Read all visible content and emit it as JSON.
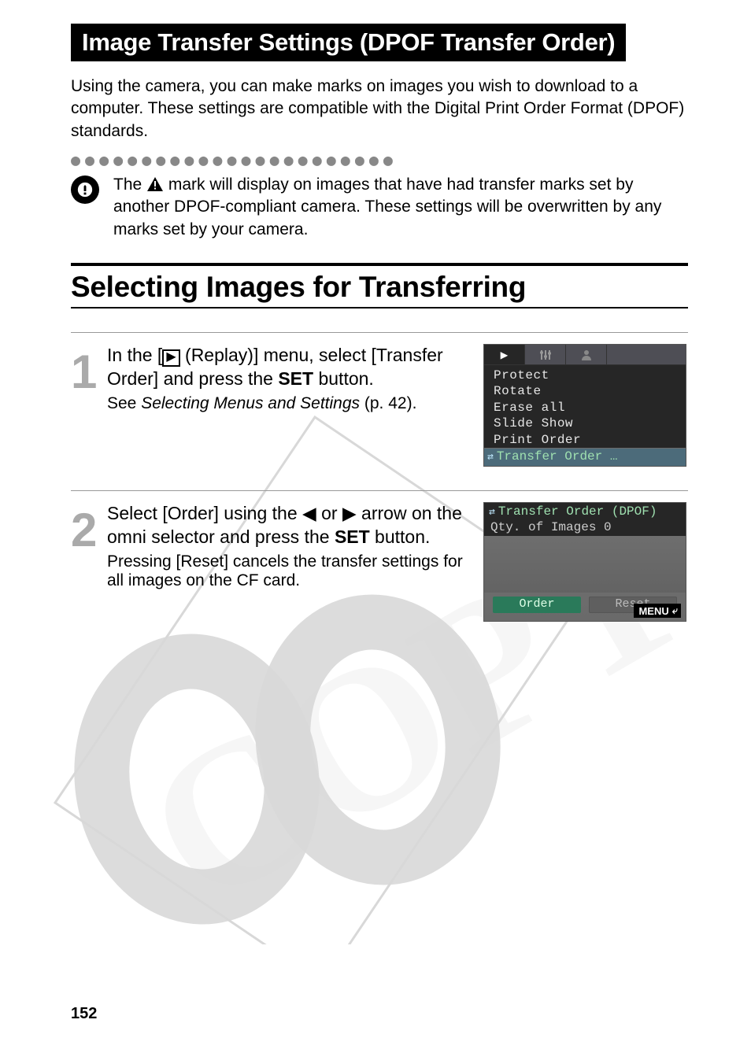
{
  "page": {
    "title": "Image Transfer Settings (DPOF Transfer Order)",
    "intro": "Using the camera, you can make marks on images you wish to download to a computer. These settings are compatible with the Digital Print Order Format (DPOF) standards.",
    "note": {
      "pre": "The ",
      "post": " mark will display on images that have had transfer marks set by another DPOF-compliant camera. These settings will be overwritten by any marks set by your camera."
    },
    "subsection_title": "Selecting Images for Transferring",
    "page_number": "152"
  },
  "steps": [
    {
      "num": "1",
      "title_parts": {
        "p1": "In the [",
        "p2": " (Replay)] menu, select [Transfer Order] and press the ",
        "set": "SET",
        "p3": " button."
      },
      "extra_pre": "See ",
      "extra_em": "Selecting Menus and Settings",
      "extra_post": " (p. 42).",
      "menu": {
        "items": [
          "Protect",
          "Rotate",
          "Erase all",
          "Slide Show",
          "Print Order"
        ],
        "selected": "Transfer Order …"
      }
    },
    {
      "num": "2",
      "title_parts": {
        "p1": "Select [Order] using the ",
        "left": "◀",
        "mid": " or ",
        "right": "▶",
        "p2": " arrow on the omni selector and press the ",
        "set": "SET",
        "p3": " button."
      },
      "extra": "Pressing [Reset] cancels the transfer settings for all images on the CF card.",
      "screen": {
        "title": "Transfer Order (DPOF)",
        "row": "Qty. of Images 0",
        "btn1": "Order",
        "btn2": "Reset",
        "menu_label": "MENU"
      }
    }
  ]
}
